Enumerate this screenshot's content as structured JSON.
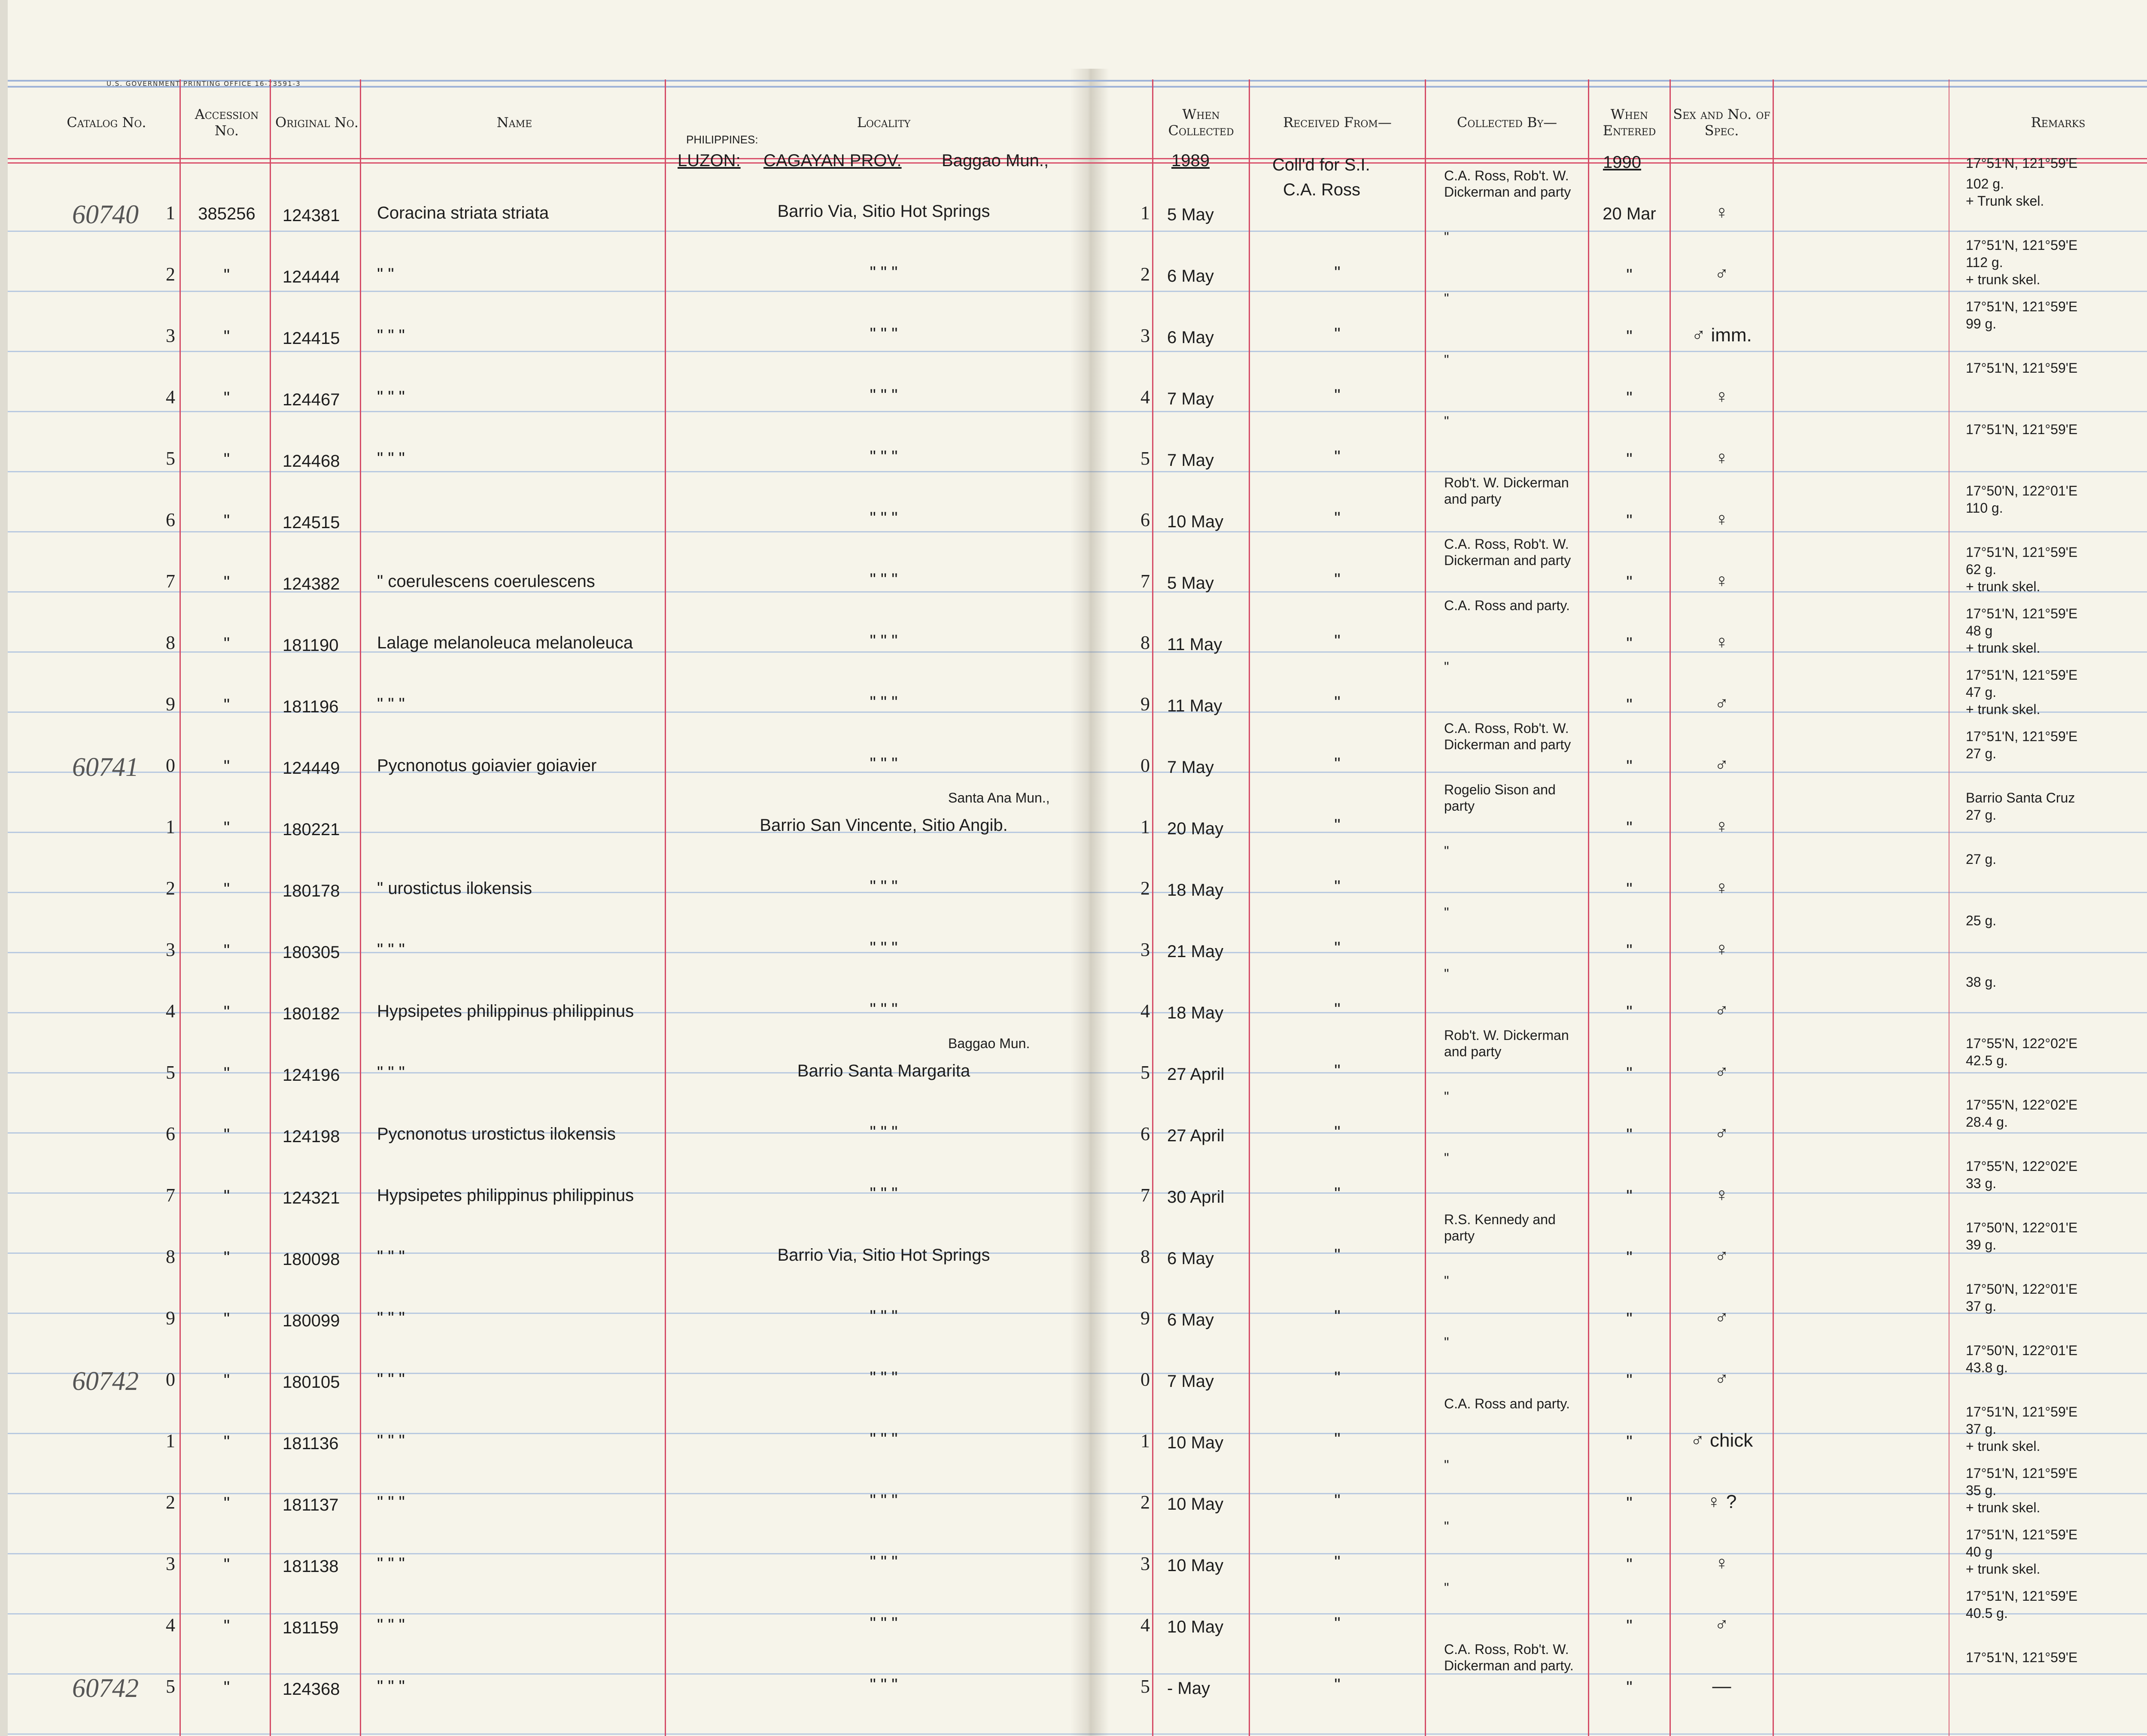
{
  "printer_line": "U.S. GOVERNMENT PRINTING OFFICE   16-73591-3",
  "headers": {
    "catalog": "Catalog No.",
    "accession": "Accession No.",
    "original": "Original No.",
    "name": "Name",
    "locality": "Locality",
    "when_collected": "When Collected",
    "received_from": "Received From—",
    "collected_by": "Collected By—",
    "when_entered": "When Entered",
    "sex": "Sex and No. of Spec.",
    "remarks": "Remarks"
  },
  "top": {
    "country": "PHILIPPINES:",
    "island": "LUZON:",
    "province": "CAGAYAN PROV.",
    "municipality": "Baggao Mun.,",
    "year_collected": "1989",
    "received_from_line1": "Coll'd for S.I.",
    "received_from_line2": "C.A. Ross",
    "year_entered": "1990",
    "remark_top": "17°51'N, 121°59'E"
  },
  "rows": [
    {
      "catalog": "60740",
      "digit": "1",
      "accession": "385256",
      "original": "124381",
      "name": "Coracina striata striata",
      "locality": "Barrio Via, Sitio Hot Springs",
      "date": "5 May",
      "received": "",
      "collector": "C.A. Ross, Rob't. W. Dickerman and party",
      "entered": "20 Mar",
      "sex": "♀",
      "remarks": [
        "102 g.",
        "+ Trunk skel."
      ]
    },
    {
      "catalog": "",
      "digit": "2",
      "accession": "\"",
      "original": "124444",
      "name": "\"    \"",
      "locality": "\"    \"    \"",
      "date": "6 May",
      "received": "\"",
      "collector": "\"",
      "entered": "\"",
      "sex": "♂",
      "remarks": [
        "17°51'N, 121°59'E",
        "112 g.",
        "+ trunk skel."
      ]
    },
    {
      "catalog": "",
      "digit": "3",
      "accession": "\"",
      "original": "124415",
      "name": "\"    \"    \"",
      "locality": "\"    \"    \"",
      "date": "6 May",
      "received": "\"",
      "collector": "\"",
      "entered": "\"",
      "sex": "♂ imm.",
      "remarks": [
        "17°51'N, 121°59'E",
        "99 g."
      ]
    },
    {
      "catalog": "",
      "digit": "4",
      "accession": "\"",
      "original": "124467",
      "name": "\"    \"    \"",
      "locality": "\"    \"    \"",
      "date": "7 May",
      "received": "\"",
      "collector": "\"",
      "entered": "\"",
      "sex": "♀",
      "remarks": [
        "17°51'N, 121°59'E"
      ]
    },
    {
      "catalog": "",
      "digit": "5",
      "accession": "\"",
      "original": "124468",
      "name": "\"    \"    \"",
      "locality": "\"    \"    \"",
      "date": "7 May",
      "received": "\"",
      "collector": "\"",
      "entered": "\"",
      "sex": "♀",
      "remarks": [
        "17°51'N, 121°59'E"
      ]
    },
    {
      "catalog": "",
      "digit": "6",
      "accession": "\"",
      "original": "124515",
      "name": "",
      "locality": "\"    \"    \"",
      "date": "10 May",
      "received": "\"",
      "collector": "Rob't. W. Dickerman and party",
      "entered": "\"",
      "sex": "♀",
      "remarks": [
        "17°50'N, 122°01'E",
        "110 g."
      ]
    },
    {
      "catalog": "",
      "digit": "7",
      "accession": "\"",
      "original": "124382",
      "name": "\"  coerulescens coerulescens",
      "locality": "\"    \"    \"",
      "date": "5 May",
      "received": "\"",
      "collector": "C.A. Ross, Rob't. W. Dickerman and party",
      "entered": "\"",
      "sex": "♀",
      "remarks": [
        "17°51'N, 121°59'E",
        "62 g.",
        "+ trunk skel."
      ]
    },
    {
      "catalog": "",
      "digit": "8",
      "accession": "\"",
      "original": "181190",
      "name": "Lalage melanoleuca melanoleuca",
      "locality": "\"    \"    \"",
      "date": "11 May",
      "received": "\"",
      "collector": "C.A. Ross and party.",
      "entered": "\"",
      "sex": "♀",
      "remarks": [
        "17°51'N, 121°59'E",
        "48 g",
        "+ trunk skel."
      ]
    },
    {
      "catalog": "",
      "digit": "9",
      "accession": "\"",
      "original": "181196",
      "name": "\"    \"    \"",
      "locality": "\"    \"    \"",
      "date": "11 May",
      "received": "\"",
      "collector": "\"",
      "entered": "\"",
      "sex": "♂",
      "remarks": [
        "17°51'N, 121°59'E",
        "47 g.",
        "+ trunk skel."
      ]
    },
    {
      "catalog": "60741",
      "digit": "0",
      "accession": "\"",
      "original": "124449",
      "name": "Pycnonotus goiavier goiavier",
      "locality": "\"    \"    \"",
      "date": "7 May",
      "received": "\"",
      "collector": "C.A. Ross, Rob't. W. Dickerman and party",
      "entered": "\"",
      "sex": "♂",
      "remarks": [
        "17°51'N, 121°59'E",
        "27 g."
      ]
    },
    {
      "catalog": "",
      "digit": "1",
      "accession": "\"",
      "original": "180221",
      "name": "",
      "locality": "Barrio San Vincente, Sitio Angib.",
      "locality_note": "Santa Ana Mun.,",
      "date": "20 May",
      "received": "\"",
      "collector": "Rogelio Sison and party",
      "entered": "\"",
      "sex": "♀",
      "remarks": [
        "Barrio Santa Cruz",
        "27 g."
      ]
    },
    {
      "catalog": "",
      "digit": "2",
      "accession": "\"",
      "original": "180178",
      "name": "\"  urostictus ilokensis",
      "locality": "\"    \"    \"",
      "date": "18 May",
      "received": "\"",
      "collector": "\"",
      "entered": "\"",
      "sex": "♀",
      "remarks": [
        "27 g."
      ]
    },
    {
      "catalog": "",
      "digit": "3",
      "accession": "\"",
      "original": "180305",
      "name": "\"    \"    \"",
      "locality": "\"    \"    \"",
      "date": "21 May",
      "received": "\"",
      "collector": "\"",
      "entered": "\"",
      "sex": "♀",
      "remarks": [
        "25 g."
      ]
    },
    {
      "catalog": "",
      "digit": "4",
      "accession": "\"",
      "original": "180182",
      "name": "Hypsipetes philippinus philippinus",
      "locality": "\"    \"    \"",
      "date": "18 May",
      "received": "\"",
      "collector": "\"",
      "entered": "\"",
      "sex": "♂",
      "remarks": [
        "38 g."
      ]
    },
    {
      "catalog": "",
      "digit": "5",
      "accession": "\"",
      "original": "124196",
      "name": "\"    \"    \"",
      "locality": "Barrio Santa Margarita",
      "locality_note": "Baggao Mun.",
      "date": "27 April",
      "received": "\"",
      "collector": "Rob't. W. Dickerman and party",
      "entered": "\"",
      "sex": "♂",
      "remarks": [
        "17°55'N, 122°02'E",
        "42.5 g."
      ]
    },
    {
      "catalog": "",
      "digit": "6",
      "accession": "\"",
      "original": "124198",
      "name": "Pycnonotus urostictus ilokensis",
      "locality": "\"    \"    \"",
      "date": "27 April",
      "received": "\"",
      "collector": "\"",
      "entered": "\"",
      "sex": "♂",
      "remarks": [
        "17°55'N, 122°02'E",
        "28.4 g."
      ]
    },
    {
      "catalog": "",
      "digit": "7",
      "accession": "\"",
      "original": "124321",
      "name": "Hypsipetes philippinus philippinus",
      "locality": "\"    \"    \"",
      "date": "30 April",
      "received": "\"",
      "collector": "\"",
      "entered": "\"",
      "sex": "♀",
      "remarks": [
        "17°55'N, 122°02'E",
        "33 g."
      ]
    },
    {
      "catalog": "",
      "digit": "8",
      "accession": "\"",
      "original": "180098",
      "name": "\"    \"    \"",
      "locality": "Barrio Via, Sitio Hot Springs",
      "date": "6 May",
      "received": "\"",
      "collector": "R.S. Kennedy and party",
      "entered": "\"",
      "sex": "♂",
      "remarks": [
        "17°50'N, 122°01'E",
        "39 g."
      ]
    },
    {
      "catalog": "",
      "digit": "9",
      "accession": "\"",
      "original": "180099",
      "name": "\"    \"    \"",
      "locality": "\"    \"    \"",
      "date": "6 May",
      "received": "\"",
      "collector": "\"",
      "entered": "\"",
      "sex": "♂",
      "remarks": [
        "17°50'N, 122°01'E",
        "37 g."
      ]
    },
    {
      "catalog": "60742",
      "digit": "0",
      "accession": "\"",
      "original": "180105",
      "name": "\"    \"    \"",
      "locality": "\"    \"    \"",
      "date": "7 May",
      "received": "\"",
      "collector": "\"",
      "entered": "\"",
      "sex": "♂",
      "remarks": [
        "17°50'N, 122°01'E",
        "43.8 g."
      ]
    },
    {
      "catalog": "",
      "digit": "1",
      "accession": "\"",
      "original": "181136",
      "name": "\"    \"    \"",
      "locality": "\"    \"    \"",
      "date": "10 May",
      "received": "\"",
      "collector": "C.A. Ross and party.",
      "entered": "\"",
      "sex": "♂ chick",
      "remarks": [
        "17°51'N, 121°59'E",
        "37 g.",
        "+ trunk skel."
      ]
    },
    {
      "catalog": "",
      "digit": "2",
      "accession": "\"",
      "original": "181137",
      "name": "\"    \"    \"",
      "locality": "\"    \"    \"",
      "date": "10 May",
      "received": "\"",
      "collector": "\"",
      "entered": "\"",
      "sex": "♀ ?",
      "remarks": [
        "17°51'N, 121°59'E",
        "35 g.",
        "+ trunk skel."
      ]
    },
    {
      "catalog": "",
      "digit": "3",
      "accession": "\"",
      "original": "181138",
      "name": "\"    \"    \"",
      "locality": "\"    \"    \"",
      "date": "10 May",
      "received": "\"",
      "collector": "\"",
      "entered": "\"",
      "sex": "♀",
      "remarks": [
        "17°51'N, 121°59'E",
        "40 g",
        "+ trunk skel."
      ]
    },
    {
      "catalog": "",
      "digit": "4",
      "accession": "\"",
      "original": "181159",
      "name": "\"    \"    \"",
      "locality": "\"    \"    \"",
      "date": "10 May",
      "received": "\"",
      "collector": "\"",
      "entered": "\"",
      "sex": "♂",
      "remarks": [
        "17°51'N, 121°59'E",
        "40.5 g."
      ]
    },
    {
      "catalog": "60742",
      "digit": "5",
      "accession": "\"",
      "original": "124368",
      "name": "\"    \"    \"",
      "locality": "\"    \"    \"",
      "date": "- May",
      "received": "\"",
      "collector": "C.A. Ross, Rob't. W. Dickerman and party.",
      "entered": "\"",
      "sex": "—",
      "remarks": [
        "17°51'N, 121°59'E"
      ]
    }
  ]
}
